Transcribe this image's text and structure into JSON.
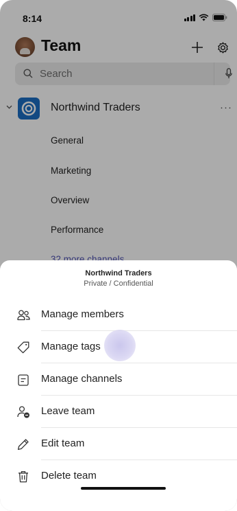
{
  "status_bar": {
    "time": "8:14"
  },
  "header": {
    "title": "Team"
  },
  "search": {
    "placeholder": "Search"
  },
  "team": {
    "name": "Northwind Traders",
    "more": "···",
    "channels": [
      "General",
      "Marketing",
      "Overview",
      "Performance"
    ],
    "more_channels": "32 more channels"
  },
  "sheet": {
    "title": "Northwind Traders",
    "subtitle": "Private / Confidential",
    "items": [
      {
        "label": "Manage members",
        "icon": "people-icon"
      },
      {
        "label": "Manage tags",
        "icon": "tag-icon"
      },
      {
        "label": "Manage channels",
        "icon": "channel-list-icon"
      },
      {
        "label": "Leave team",
        "icon": "person-leave-icon"
      },
      {
        "label": "Edit team",
        "icon": "pencil-icon"
      },
      {
        "label": "Delete team",
        "icon": "trash-icon"
      }
    ]
  },
  "colors": {
    "accent": "#4f52b2",
    "team_logo": "#1b6ec2"
  }
}
